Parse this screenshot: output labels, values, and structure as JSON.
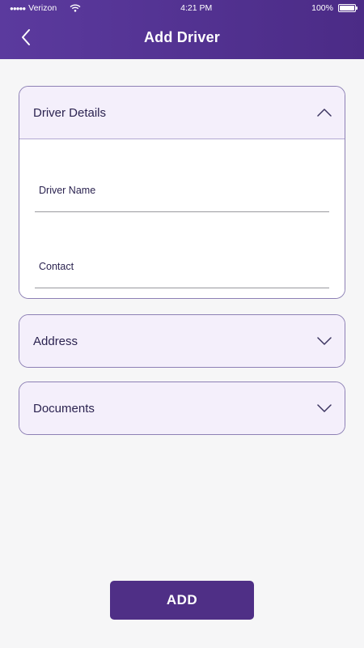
{
  "status_bar": {
    "carrier": "Verizon",
    "time": "4:21 PM",
    "battery": "100%"
  },
  "app_bar": {
    "title": "Add Driver"
  },
  "sections": {
    "driver_details": {
      "title": "Driver Details",
      "expanded": true,
      "fields": {
        "driver_name_label": "Driver Name",
        "driver_name_value": "",
        "contact_label": "Contact",
        "contact_value": ""
      }
    },
    "address": {
      "title": "Address",
      "expanded": false
    },
    "documents": {
      "title": "Documents",
      "expanded": false
    }
  },
  "actions": {
    "add_label": "ADD"
  },
  "colors": {
    "header_start": "#5b3a9e",
    "header_end": "#4b2b86",
    "button": "#4f2f86",
    "card_head_bg": "#f4effb",
    "card_border": "#8d80b5"
  },
  "icons": {
    "back": "chevron-left-icon",
    "collapse": "chevron-up-icon",
    "expand": "chevron-down-icon"
  }
}
